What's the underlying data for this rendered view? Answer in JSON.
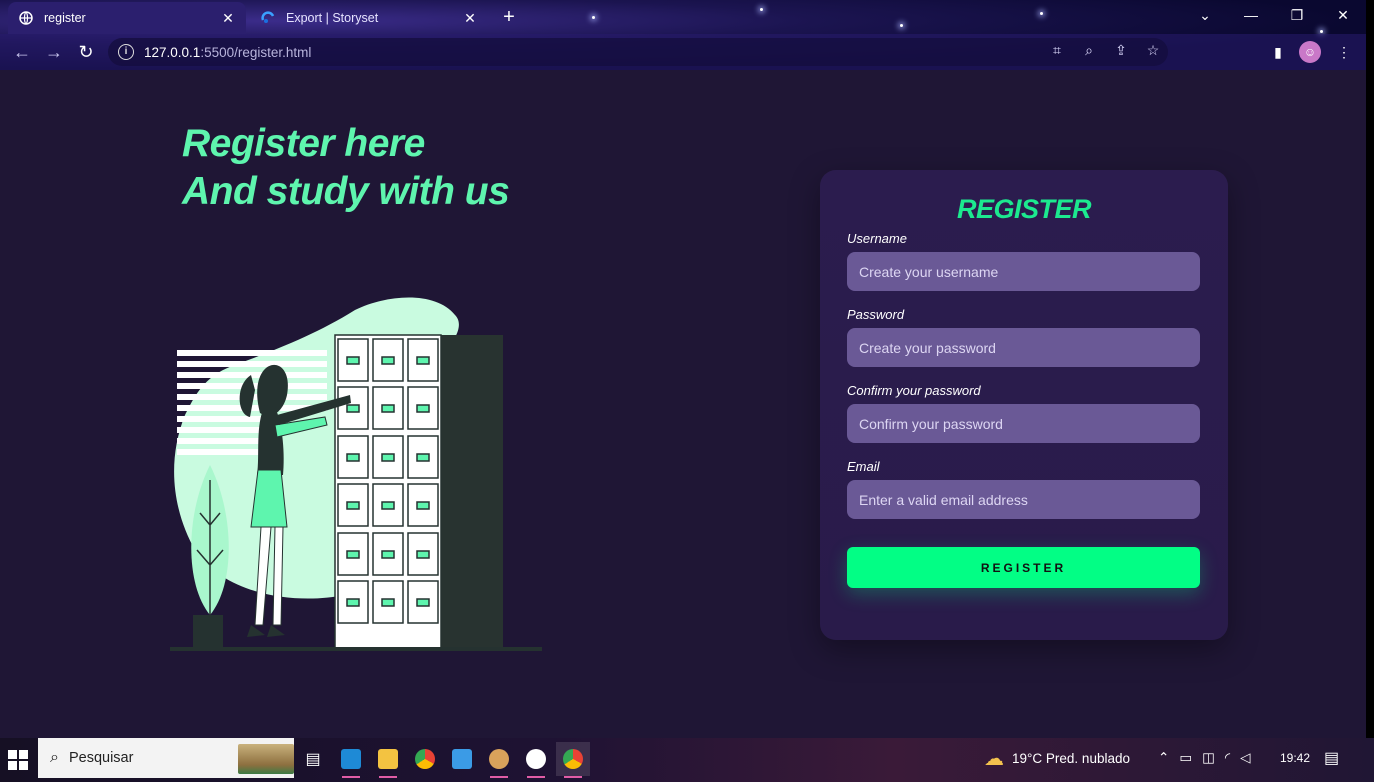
{
  "browser": {
    "tabs": [
      {
        "title": "register",
        "active": true
      },
      {
        "title": "Export | Storyset",
        "active": false
      }
    ],
    "url_host": "127.0.0.1",
    "url_rest": ":5500/register.html"
  },
  "page": {
    "headline_line1": "Register here",
    "headline_line2": "And study with us",
    "form": {
      "title": "REGISTER",
      "username_label": "Username",
      "username_placeholder": "Create your username",
      "password_label": "Password",
      "password_placeholder": "Create your password",
      "confirm_label": "Confirm your password",
      "confirm_placeholder": "Confirm your password",
      "email_label": "Email",
      "email_placeholder": "Enter a valid email address",
      "submit_label": "REGISTER"
    }
  },
  "taskbar": {
    "search_placeholder": "Pesquisar",
    "weather": "19°C  Pred. nublado",
    "time": "19:42"
  },
  "colors": {
    "accent": "#1ce98f",
    "button": "#02fe85",
    "page_bg": "#1f1635",
    "card_bg": "#2b1c4e",
    "input_bg": "#6a5996"
  }
}
